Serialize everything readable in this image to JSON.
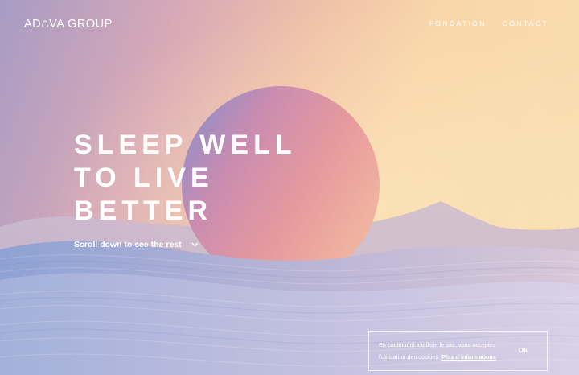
{
  "brand": {
    "logo_text_before": "AD",
    "logo_text_after": "VA GROUP"
  },
  "nav": {
    "items": [
      {
        "label": "FONDATION"
      },
      {
        "label": "CONTACT"
      }
    ]
  },
  "hero": {
    "headline_lines": [
      "SLEEP WELL",
      "TO LIVE",
      "BETTER"
    ]
  },
  "scroll": {
    "label": "Scroll down to see the rest",
    "icon": "chevron-down-icon"
  },
  "cookie": {
    "text": "En continuant à utiliser le site, vous acceptez l'utilisation des cookies.",
    "link_label": "Plus d'informations",
    "ok_label": "Ok"
  },
  "colors": {
    "sky_warm": "#f9e0b4",
    "sky_cool": "#a79bc4",
    "sphere_pink": "#e68f9e",
    "sphere_blue": "#8b94cf",
    "text": "#ffffff"
  }
}
